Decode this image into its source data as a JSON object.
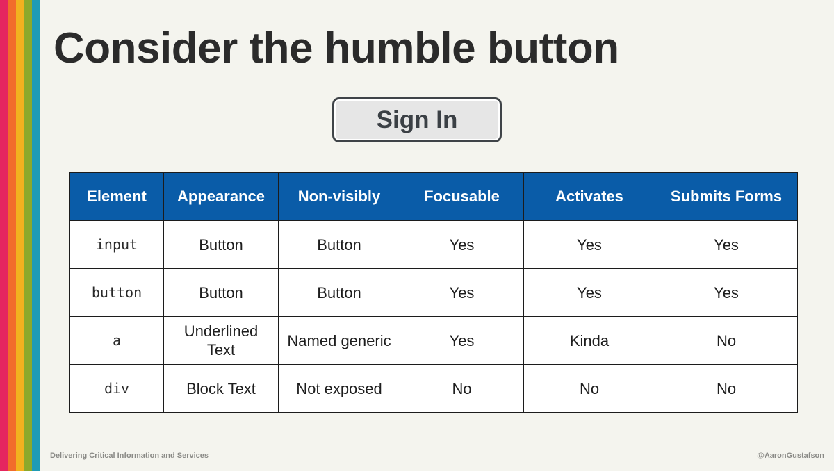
{
  "slide": {
    "title": "Consider the humble button",
    "demo_button_label": "Sign In",
    "rainbow_colors": [
      "#e5265f",
      "#f26c2b",
      "#f2b11f",
      "#8ca92b",
      "#1f9bb5"
    ]
  },
  "table": {
    "headers": [
      "Element",
      "Appearance",
      "Non-visibly",
      "Focusable",
      "Activates",
      "Submits Forms"
    ],
    "header_color": "#0a5ca8",
    "rows": [
      [
        "input",
        "Button",
        "Button",
        "Yes",
        "Yes",
        "Yes"
      ],
      [
        "button",
        "Button",
        "Button",
        "Yes",
        "Yes",
        "Yes"
      ],
      [
        "a",
        "Underlined Text",
        "Named generic",
        "Yes",
        "Kinda",
        "No"
      ],
      [
        "div",
        "Block Text",
        "Not exposed",
        "No",
        "No",
        "No"
      ]
    ]
  },
  "footer": {
    "left": "Delivering Critical Information and Services",
    "right": "@AaronGustafson"
  }
}
